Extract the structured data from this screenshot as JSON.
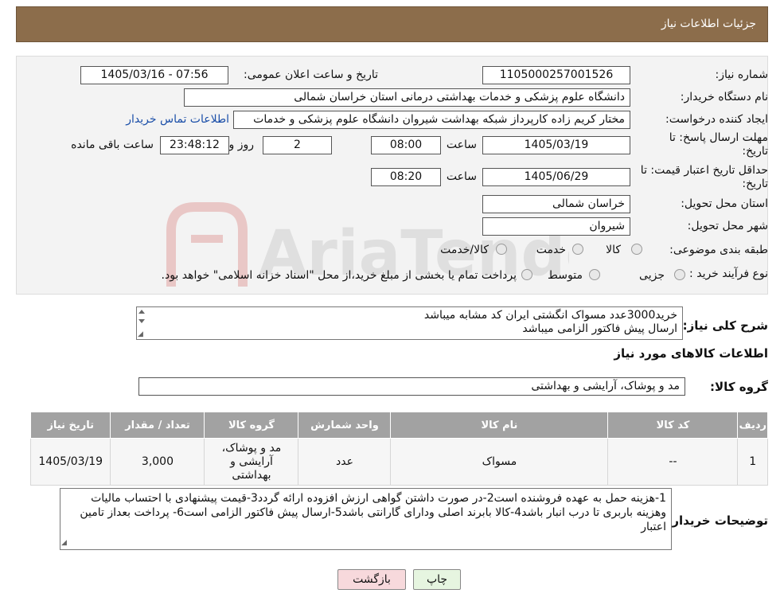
{
  "header": {
    "title": "جزئیات اطلاعات نیاز"
  },
  "form": {
    "need_number_label": "شماره نیاز:",
    "need_number": "1105000257001526",
    "announce_label": "تاریخ و ساعت اعلان عمومی:",
    "announce_value": "1405/03/16 - 07:56",
    "buyer_org_label": "نام دستگاه خریدار:",
    "buyer_org": "دانشگاه علوم پزشکی و خدمات بهداشتی درمانی استان خراسان شمالی",
    "requester_label": "ایجاد کننده درخواست:",
    "requester": "مختار کریم زاده کارپرداز شبکه بهداشت شیروان دانشگاه علوم پزشکی و خدمات",
    "contact_link": "اطلاعات تماس خریدار",
    "deadline_label": "مهلت ارسال پاسخ: تا تاریخ:",
    "deadline_date": "1405/03/19",
    "time_label": "ساعت",
    "deadline_time": "08:00",
    "days_value": "2",
    "days_label": "روز و",
    "remaining_time": "23:48:12",
    "remaining_label": "ساعت باقی مانده",
    "validity_label": "حداقل تاریخ اعتبار قیمت: تا تاریخ:",
    "validity_date": "1405/06/29",
    "validity_time": "08:20",
    "province_label": "استان محل تحویل:",
    "province": "خراسان شمالی",
    "city_label": "شهر محل تحویل:",
    "city": "شیروان",
    "category_label": "طبقه بندی موضوعی:",
    "category_options": [
      "کالا",
      "خدمت",
      "کالا/خدمت"
    ],
    "process_label": "نوع فرآیند خرید :",
    "process_options": [
      "جزیی",
      "متوسط"
    ],
    "process_note": "پرداخت تمام یا بخشی از مبلغ خرید،از محل \"اسناد خزانه اسلامی\" خواهد بود."
  },
  "description": {
    "label": "شرح کلی نیاز:",
    "line1": "خرید3000عدد مسواک انگشتی  ایران کد مشابه میباشد",
    "line2": "ارسال پیش فاکتور الزامی میباشد"
  },
  "goods": {
    "section_title": "اطلاعات کالاهای مورد نیاز",
    "group_label": "گروه کالا:",
    "group_value": "مد و پوشاک، آرایشی و بهداشتی"
  },
  "table": {
    "headers": [
      "ردیف",
      "کد کالا",
      "نام کالا",
      "واحد شمارش",
      "گروه کالا",
      "تعداد / مقدار",
      "تاریخ نیاز"
    ],
    "rows": [
      [
        "1",
        "--",
        "مسواک",
        "عدد",
        "مد و پوشاک، آرایشی و بهداشتی",
        "3,000",
        "1405/03/19"
      ]
    ]
  },
  "buyer_notes": {
    "label": "توضیحات خریدار:",
    "text": "1-هزینه حمل به عهده فروشنده است2-در صورت داشتن گواهی ارزش افزوده ارائه گردد3-قیمت پیشنهادی با احتساب مالیات وهزینه باربری تا درب انبار  باشد4-کالا بابرند اصلی ودارای گارانتی باشد5-ارسال پیش فاکتور الزامی است6- پرداخت بعداز تامین اعتبار"
  },
  "buttons": {
    "print": "چاپ",
    "back": "بازگشت"
  },
  "watermark": {
    "text": "AriaTender.neT"
  },
  "colors": {
    "header_bg": "#8c6d4b",
    "table_header_bg": "#a2a2a2",
    "back_button_bg": "#f7d9dc",
    "print_button_bg": "#e6f5e0"
  }
}
